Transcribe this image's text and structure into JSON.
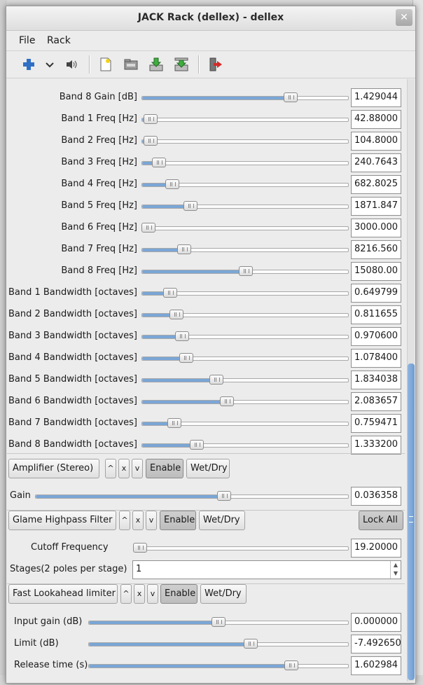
{
  "window": {
    "title": "JACK Rack (dellex) - dellex",
    "close_label": "✕"
  },
  "menu": {
    "file": "File",
    "rack": "Rack"
  },
  "toolbar": {
    "icons": [
      "add-icon",
      "dropdown-icon",
      "speaker-icon",
      "new-file-icon",
      "open-folder-icon",
      "import-icon",
      "export-icon",
      "quit-icon"
    ]
  },
  "eq": {
    "rows": [
      {
        "label": "Band 8 Gain [dB]",
        "value": "1.429044",
        "level": 0.72
      },
      {
        "label": "Band 1 Freq [Hz]",
        "value": "42.88000",
        "level": 0.04
      },
      {
        "label": "Band 2 Freq [Hz]",
        "value": "104.8000",
        "level": 0.04
      },
      {
        "label": "Band 3 Freq [Hz]",
        "value": "240.7643",
        "level": 0.08
      },
      {
        "label": "Band 4 Freq [Hz]",
        "value": "682.8025",
        "level": 0.145
      },
      {
        "label": "Band 5 Freq [Hz]",
        "value": "1871.847",
        "level": 0.235
      },
      {
        "label": "Band 6 Freq [Hz]",
        "value": "3000.000",
        "level": 0.03
      },
      {
        "label": "Band 7 Freq [Hz]",
        "value": "8216.560",
        "level": 0.205
      },
      {
        "label": "Band 8 Freq [Hz]",
        "value": "15080.00",
        "level": 0.505
      },
      {
        "label": "Band 1 Bandwidth [octaves]",
        "value": "0.649799",
        "level": 0.135
      },
      {
        "label": "Band 2 Bandwidth [octaves]",
        "value": "0.811655",
        "level": 0.165
      },
      {
        "label": "Band 3 Bandwidth [octaves]",
        "value": "0.970600",
        "level": 0.195
      },
      {
        "label": "Band 4 Bandwidth [octaves]",
        "value": "1.078400",
        "level": 0.215
      },
      {
        "label": "Band 5 Bandwidth [octaves]",
        "value": "1.834038",
        "level": 0.36
      },
      {
        "label": "Band 6 Bandwidth [octaves]",
        "value": "2.083657",
        "level": 0.41
      },
      {
        "label": "Band 7 Bandwidth [octaves]",
        "value": "0.759471",
        "level": 0.155
      },
      {
        "label": "Band 8 Bandwidth [octaves]",
        "value": "1.333200",
        "level": 0.265
      }
    ]
  },
  "amplifier": {
    "name": "Amplifier (Stereo)",
    "up": "^",
    "remove": "x",
    "down": "v",
    "enable": "Enable",
    "wetdry": "Wet/Dry",
    "gain_label": "Gain",
    "gain_value": "0.036358",
    "gain_level": 0.604
  },
  "highpass": {
    "name": "Glame Highpass Filter",
    "up": "^",
    "remove": "x",
    "down": "v",
    "enable": "Enable",
    "wetdry": "Wet/Dry",
    "lock_all": "Lock All",
    "cutoff_label": "Cutoff Frequency",
    "cutoff_value": "19.20000",
    "cutoff_level": 0.03,
    "stages_label": "Stages(2 poles per stage)",
    "stages_value": "1"
  },
  "limiter": {
    "name": "Fast Lookahead limiter",
    "up": "^",
    "remove": "x",
    "down": "v",
    "enable": "Enable",
    "wetdry": "Wet/Dry",
    "rows": [
      {
        "label": "Input gain (dB)",
        "value": "0.000000",
        "level": 0.5
      },
      {
        "label": "Limit (dB)",
        "value": "-7.492650",
        "level": 0.625
      },
      {
        "label": "Release time (s)",
        "value": "1.602984",
        "level": 0.78
      }
    ]
  }
}
